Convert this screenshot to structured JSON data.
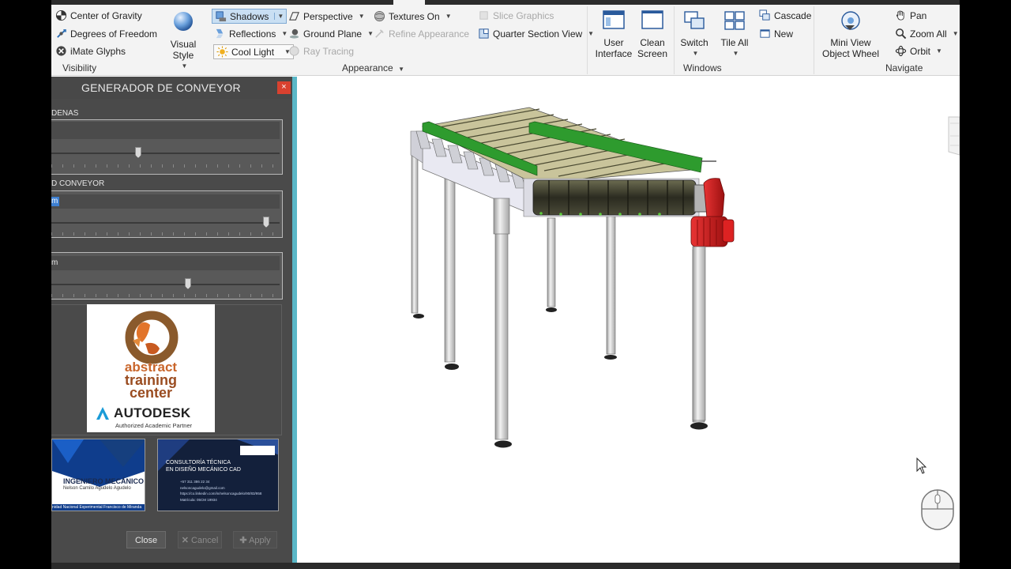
{
  "ribbon": {
    "visibility": {
      "panel_label": "Visibility",
      "items": [
        {
          "label": "Center of Gravity",
          "icon": "center-of-gravity-icon"
        },
        {
          "label": "Degrees of Freedom",
          "icon": "degrees-of-freedom-icon"
        },
        {
          "label": "iMate Glyphs",
          "icon": "imate-glyphs-icon"
        }
      ]
    },
    "appearance": {
      "panel_label": "Appearance",
      "visual_style": "Visual Style",
      "shadows": "Shadows",
      "reflections": "Reflections",
      "cool_light": "Cool Light",
      "perspective": "Perspective",
      "ground_plane": "Ground Plane",
      "ray_tracing": "Ray Tracing",
      "textures_on": "Textures On",
      "refine_appearance": "Refine Appearance",
      "slice_graphics": "Slice Graphics",
      "quarter_section_view": "Quarter Section View"
    },
    "windows": {
      "panel_label": "Windows",
      "user_interface_1": "User",
      "user_interface_2": "Interface",
      "clean_screen_1": "Clean",
      "clean_screen_2": "Screen",
      "switch": "Switch",
      "tile_all": "Tile All",
      "cascade": "Cascade",
      "new": "New"
    },
    "navigate": {
      "panel_label": "Navigate",
      "mini_view_1": "Mini View",
      "mini_view_2": "Object Wheel",
      "pan": "Pan",
      "zoom_all": "Zoom All",
      "orbit": "Orbit"
    }
  },
  "dialog": {
    "title": "GENERADOR DE CONVEYOR",
    "close_glyph": "×",
    "label_cadenas": "DENAS",
    "label_conveyor": "D CONVEYOR",
    "field_unit_1": "m",
    "field_unit_2": "m",
    "slider_positions": [
      0.38,
      0.94,
      0.6
    ],
    "logo": {
      "line1": "abstract",
      "line2": "training",
      "line3": "center",
      "brand": "AUTODESK",
      "partner": "Authorized Academic Partner"
    },
    "card1": {
      "title": "INGENIERO MECÁNICO",
      "name": "Nelson Camilo Agudelo Agudelo",
      "footer": "nidad Nacional Experimental Francisco de Miranda"
    },
    "card2": {
      "title1": "CONSULTORÍA TÉCNICA",
      "title2": "EN DISEÑO MECÁNICO CAD",
      "phone": "+57 311 386 22 34",
      "email": "nelsoncagudelo@gmail.com",
      "web": "https://co.linkedin.com/in/nelsoncagudelo/90/83/958",
      "reg": "Matrícula: 05CM 19934"
    },
    "buttons": {
      "close": "Close",
      "cancel": "Cancel",
      "apply": "Apply"
    }
  },
  "colors": {
    "dialog_accent": "#5ab7c7",
    "conveyor_green": "#2e9b2e",
    "motor_red": "#cc1f1f",
    "roller_dark": "#3c3c2c"
  }
}
